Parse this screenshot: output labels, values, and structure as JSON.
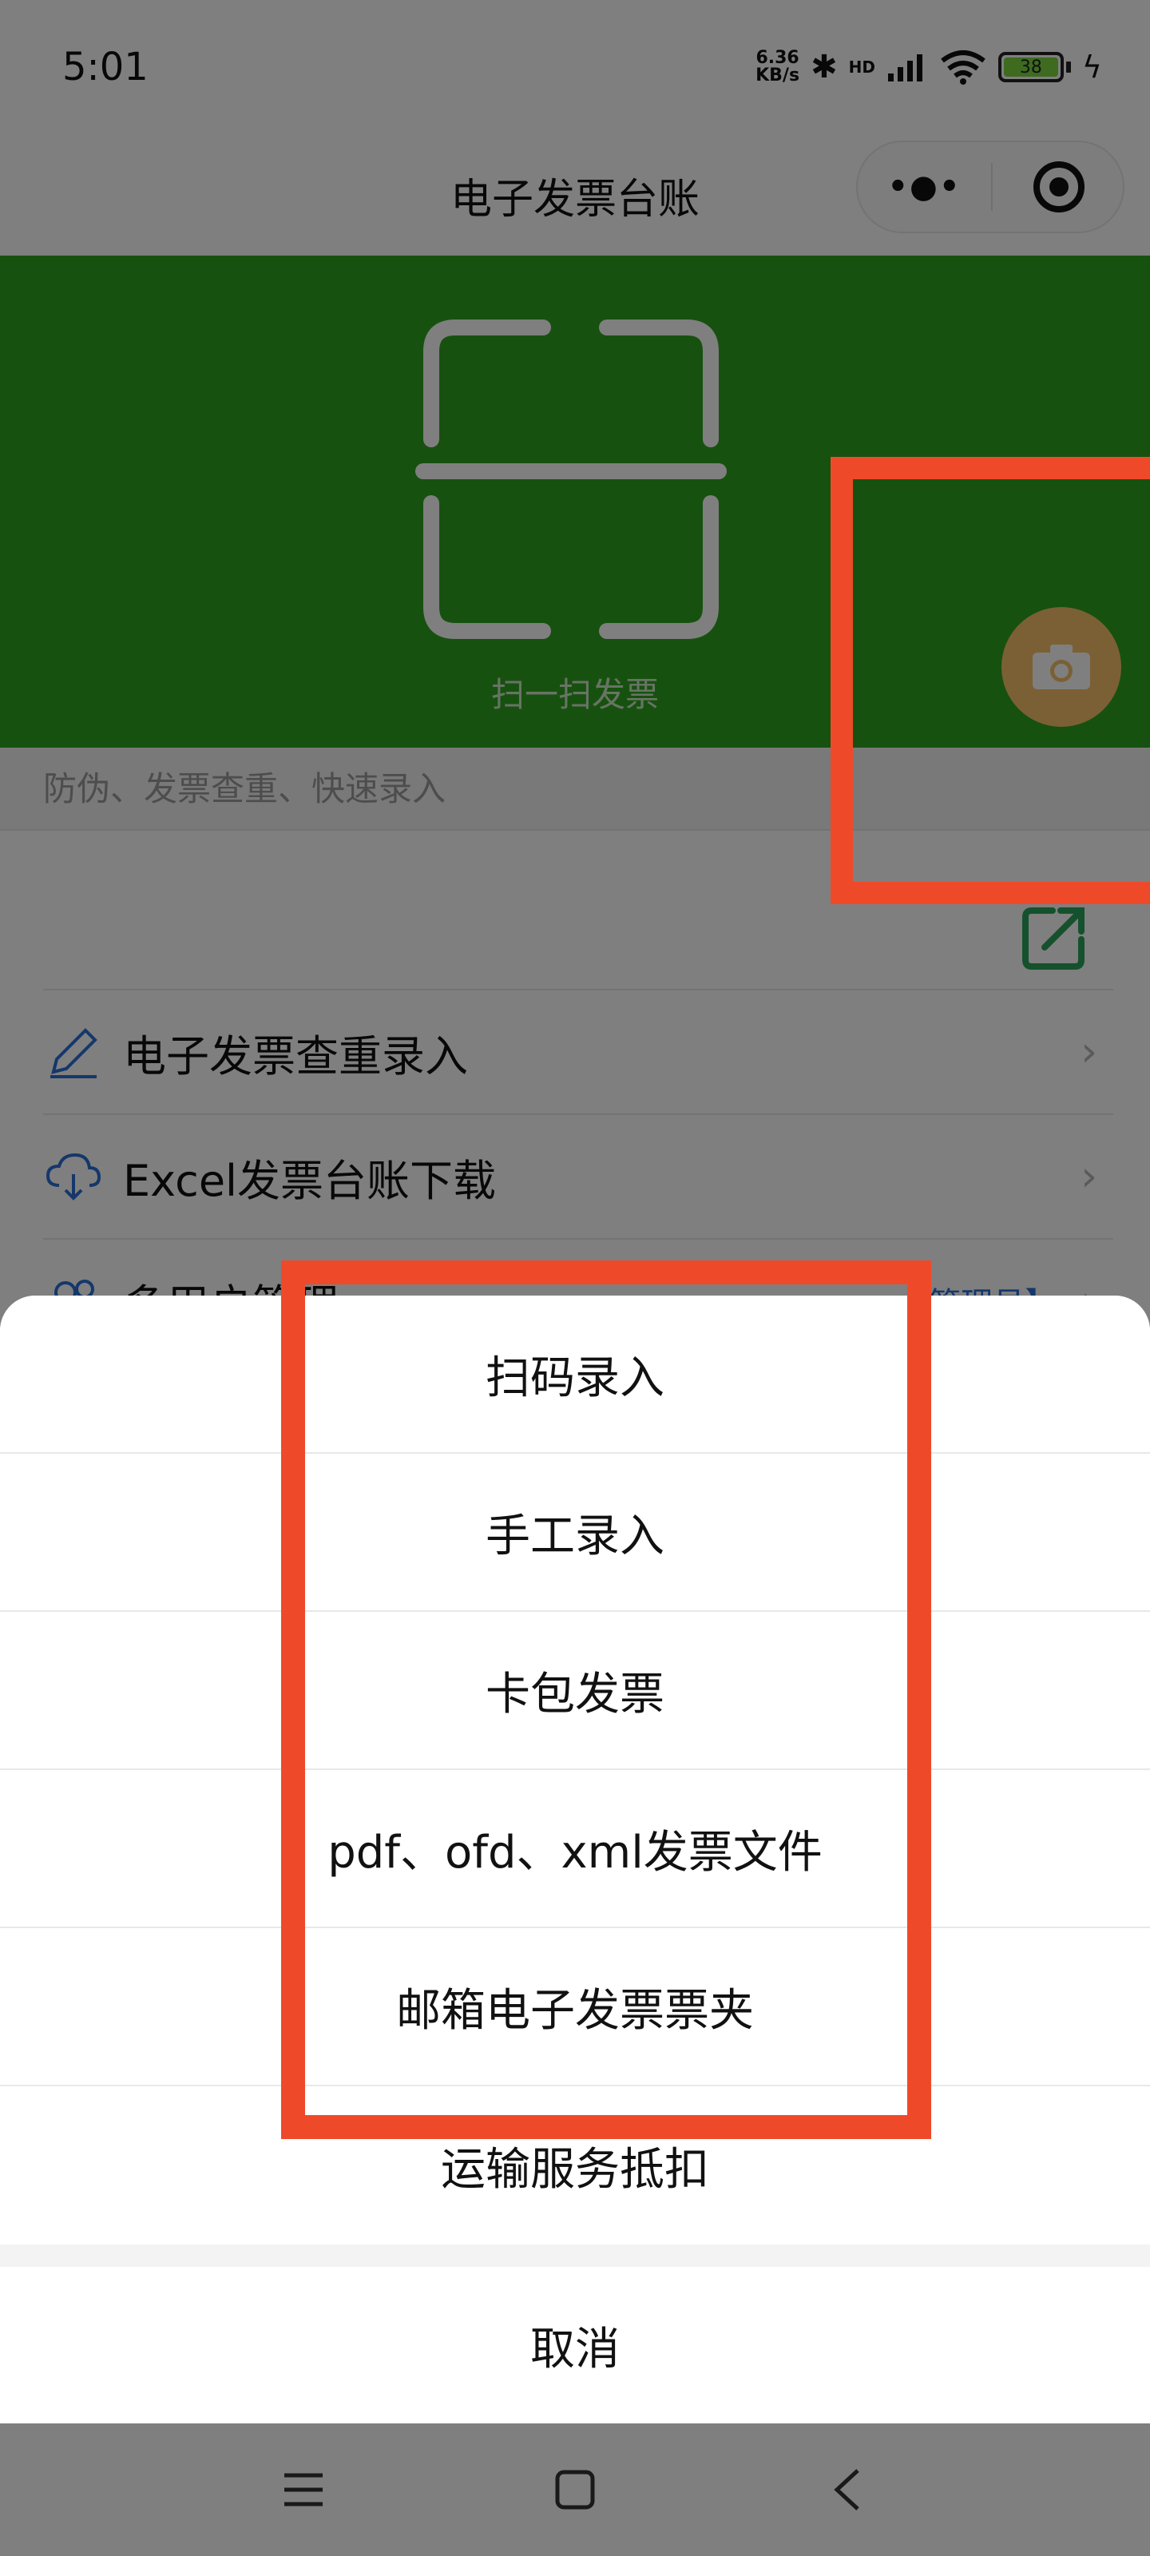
{
  "status_bar": {
    "time": "5:01",
    "net_speed_value": "6.36",
    "net_speed_unit": "KB/s",
    "signal_label": "HD",
    "battery_level": "38"
  },
  "header": {
    "title": "电子发票台账",
    "more_icon": "more-dots-icon",
    "close_icon": "target-circle-icon"
  },
  "banner": {
    "scan_label": "扫一扫发票",
    "subtitle": "防伪、发票查重、快速录入",
    "background_color": "#2fa21f",
    "camera_button_color": "#f6c06a"
  },
  "menu": {
    "items": [
      {
        "label": "电子发票查重录入",
        "icon": "pencil-icon"
      },
      {
        "label": "Excel发票台账下载",
        "icon": "cloud-download-icon"
      },
      {
        "label": "多用户管理",
        "icon": "users-icon",
        "tag": "【管理员】"
      }
    ]
  },
  "action_sheet": {
    "options": [
      {
        "label": "扫码录入"
      },
      {
        "label": "手工录入"
      },
      {
        "label": "卡包发票"
      },
      {
        "label": "pdf、ofd、xml发票文件"
      },
      {
        "label": "邮箱电子发票票夹"
      },
      {
        "label": "运输服务抵扣"
      }
    ],
    "cancel_label": "取消"
  },
  "highlight_color": "#ee4a2a"
}
